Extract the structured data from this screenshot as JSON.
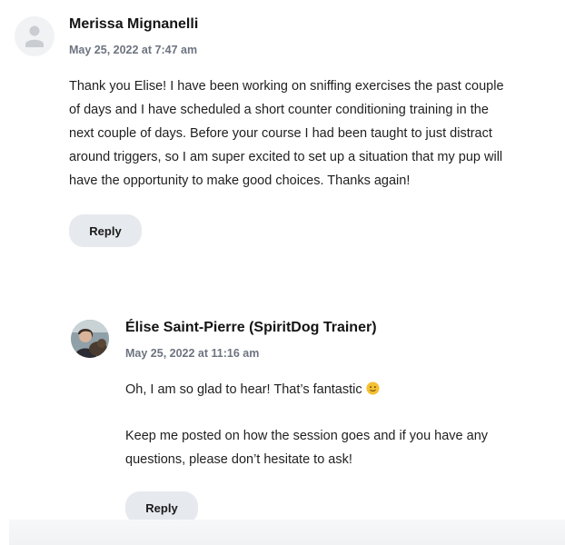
{
  "comments": [
    {
      "author": "Merissa Mignanelli",
      "date": "May 25, 2022 at 7:47 am",
      "paragraphs": [
        "Thank you Elise! I have been working on sniffing exercises the past couple of days and I have scheduled a short counter conditioning training in the next couple of days. Before your course I had been taught to just distract around triggers, so I am super excited to set up a situation that my pup will have the opportunity to make good choices. Thanks again!"
      ],
      "reply_label": "Reply",
      "avatar_icon": "default-user-icon"
    }
  ],
  "reply": {
    "author": "Élise Saint-Pierre (SpiritDog Trainer)",
    "date": "May 25, 2022 at 11:16 am",
    "paragraph1": "Oh, I am so glad to hear! That’s fantastic",
    "emoji_icon": "smiling-face-icon",
    "paragraph2": "Keep me posted on how the session goes and if you have any questions, please don’t hesitate to ask!",
    "reply_label": "Reply",
    "avatar_icon": "trainer-photo-avatar"
  },
  "colors": {
    "date": "#6d7480",
    "reply_button_bg": "#e6e9ee",
    "avatar_default_bg": "#f1f2f4",
    "emoji": "#f5c032"
  }
}
